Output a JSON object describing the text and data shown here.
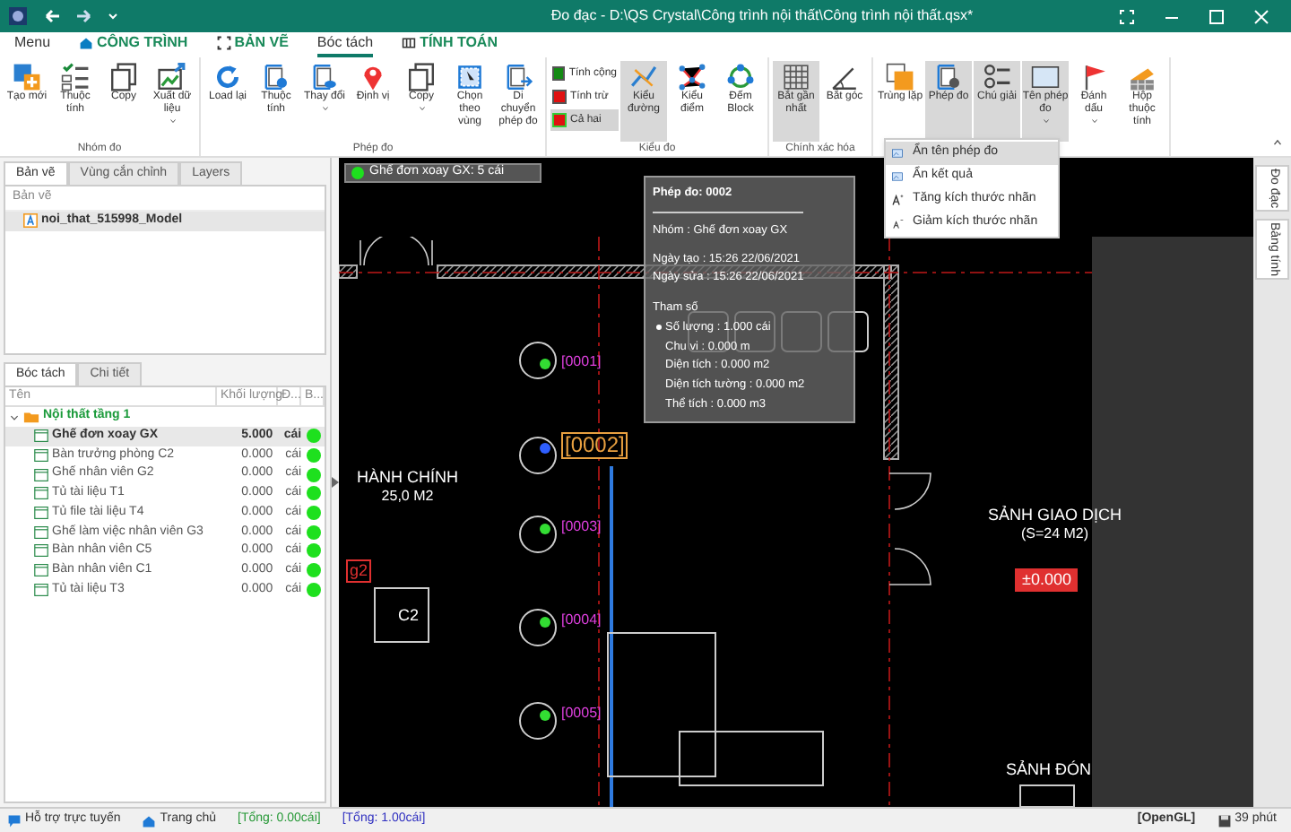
{
  "window": {
    "title": "Đo đạc - D:\\QS Crystal\\Công trình nội thất\\Công trình nội thất.qsx*"
  },
  "menu_tabs": [
    {
      "label": "Menu",
      "selected": false,
      "kind": "plain"
    },
    {
      "label": "CÔNG TRÌNH",
      "selected": false,
      "kind": "module"
    },
    {
      "label": "BẢN VẼ",
      "selected": false,
      "kind": "module"
    },
    {
      "label": "Bóc tách",
      "selected": true,
      "kind": "plain"
    },
    {
      "label": "TÍNH TOÁN",
      "selected": false,
      "kind": "module"
    }
  ],
  "ribbon": [
    {
      "label": "Nhóm đo",
      "items": [
        {
          "kind": "button",
          "label": "Tạo mới",
          "active": false,
          "dropdown": false
        },
        {
          "kind": "button",
          "label": "Thuộc tính",
          "active": false,
          "dropdown": false
        },
        {
          "kind": "button",
          "label": "Copy",
          "active": false,
          "dropdown": false
        },
        {
          "kind": "button",
          "label": "Xuất dữ liệu",
          "active": false,
          "dropdown": true
        }
      ]
    },
    {
      "label": "Phép đo",
      "items": [
        {
          "kind": "button",
          "label": "Load lại",
          "active": false,
          "dropdown": false
        },
        {
          "kind": "button",
          "label": "Thuộc tính",
          "active": false,
          "dropdown": false
        },
        {
          "kind": "button",
          "label": "Thay đổi",
          "active": false,
          "dropdown": true
        },
        {
          "kind": "button",
          "label": "Định vị",
          "active": false,
          "dropdown": false
        },
        {
          "kind": "button",
          "label": "Copy",
          "active": false,
          "dropdown": true
        },
        {
          "kind": "button",
          "label": "Chọn theo vùng",
          "active": false,
          "dropdown": false
        },
        {
          "kind": "button",
          "label": "Di chuyển phép đo",
          "active": false,
          "dropdown": false
        }
      ]
    },
    {
      "label": "Kiểu đo",
      "items": [
        {
          "kind": "checks",
          "options": [
            {
              "label": "Tính cộng",
              "color": "#138a13",
              "selected": false
            },
            {
              "label": "Tính trừ",
              "color": "#e01010",
              "selected": false
            },
            {
              "label": "Cả hai",
              "color": "#e01010",
              "selected": true
            }
          ]
        },
        {
          "kind": "button",
          "label": "Kiểu đường",
          "active": true,
          "dropdown": false
        },
        {
          "kind": "button",
          "label": "Kiểu điểm",
          "active": false,
          "dropdown": false
        },
        {
          "kind": "button",
          "label": "Đếm Block",
          "active": false,
          "dropdown": false
        }
      ]
    },
    {
      "label": "Chính xác hóa",
      "items": [
        {
          "kind": "button",
          "label": "Bắt gần nhất",
          "active": true,
          "dropdown": false
        },
        {
          "kind": "button",
          "label": "Bắt góc",
          "active": false,
          "dropdown": false
        }
      ]
    },
    {
      "items": [
        {
          "kind": "button",
          "label": "Trùng lặp",
          "active": false,
          "dropdown": false
        },
        {
          "kind": "button",
          "label": "Phép đo",
          "active": true,
          "dropdown": false
        },
        {
          "kind": "button",
          "label": "Chú giải",
          "active": true,
          "dropdown": false
        },
        {
          "kind": "button",
          "label": "Tên phép đo",
          "active": true,
          "dropdown": true
        },
        {
          "kind": "button",
          "label": "Đánh dấu",
          "active": false,
          "dropdown": true
        },
        {
          "kind": "button",
          "label": "Hộp thuộc tính",
          "active": false,
          "dropdown": false
        }
      ]
    }
  ],
  "dropdown_menu": [
    {
      "label": "Ẩn tên phép đo",
      "selected": true
    },
    {
      "label": "Ẩn kết quả",
      "selected": false
    },
    {
      "label": "Tăng kích thước nhãn",
      "selected": false
    },
    {
      "label": "Giảm kích thước nhãn",
      "selected": false
    }
  ],
  "drawing_panel": {
    "tabs": [
      {
        "label": "Bản vẽ",
        "selected": true
      },
      {
        "label": "Vùng cắn chỉnh",
        "selected": false
      },
      {
        "label": "Layers",
        "selected": false
      }
    ],
    "header": "Bản vẽ",
    "items": [
      {
        "label": "noi_that_515998_Model",
        "selected": true
      }
    ]
  },
  "takeoff_panel": {
    "tabs": [
      {
        "label": "Bóc tách",
        "selected": true
      },
      {
        "label": "Chi tiết",
        "selected": false
      }
    ],
    "columns": [
      "Tên",
      "Khối lượng",
      "Đ...",
      "B..."
    ],
    "tree": [
      {
        "label": "Nội thất tầng 1",
        "expanded": true,
        "children": [
          {
            "label": "Ghế đơn xoay GX",
            "quantity": "5.000",
            "unit": "cái",
            "selected": true
          },
          {
            "label": "Bàn trưởng phòng C2",
            "quantity": "0.000",
            "unit": "cái",
            "selected": false
          },
          {
            "label": "Ghế nhân viên G2",
            "quantity": "0.000",
            "unit": "cái",
            "selected": false
          },
          {
            "label": "Tủ tài liệu T1",
            "quantity": "0.000",
            "unit": "cái",
            "selected": false
          },
          {
            "label": "Tủ file tài liệu T4",
            "quantity": "0.000",
            "unit": "cái",
            "selected": false
          },
          {
            "label": "Ghế làm việc nhân viên G3",
            "quantity": "0.000",
            "unit": "cái",
            "selected": false
          },
          {
            "label": "Bàn nhân viên C5",
            "quantity": "0.000",
            "unit": "cái",
            "selected": false
          },
          {
            "label": "Bàn nhân viên C1",
            "quantity": "0.000",
            "unit": "cái",
            "selected": false
          },
          {
            "label": "Tủ tài liệu T3",
            "quantity": "0.000",
            "unit": "cái",
            "selected": false
          }
        ]
      }
    ]
  },
  "canvas": {
    "legend": "Ghế đơn xoay GX: 5 cái",
    "tooltip": {
      "title": "Phép đo: 0002",
      "group": "Nhóm : Ghế đơn xoay GX",
      "created": "Ngày tạo : 15:26 22/06/2021",
      "modified": "Ngày sửa : 15:26 22/06/2021",
      "params_title": "Tham số",
      "params": [
        "Số lượng : 1.000 cái",
        "Chu vi : 0.000 m",
        "Diện tích : 0.000 m2",
        "Diện tích tường : 0.000 m2",
        "Thể tích : 0.000 m3"
      ]
    },
    "markers": [
      {
        "label": "[0001]",
        "selected": false
      },
      {
        "label": "[0002]",
        "selected": true
      },
      {
        "label": "[0003]",
        "selected": false
      },
      {
        "label": "[0004]",
        "selected": false
      },
      {
        "label": "[0005]",
        "selected": false
      }
    ],
    "rooms": [
      {
        "name": "HÀNH CHÍNH",
        "area": "25,0 M2"
      },
      {
        "name": "SẢNH GIAO DỊCH",
        "area": "(S=24 M2)"
      },
      {
        "name": "SẢNH ĐÓN"
      }
    ],
    "level_mark": "±0.000",
    "tags": [
      "g2",
      "C2"
    ]
  },
  "side_tabs": [
    "Đo đạc",
    "Bảng tính"
  ],
  "status_bar": {
    "support": "Hỗ trợ trực tuyến",
    "home": "Trang chủ",
    "total_1": "[Tổng: 0.00cái]",
    "total_2": "[Tổng: 1.00cái]",
    "renderer": "[OpenGL]",
    "time": "39 phút"
  }
}
